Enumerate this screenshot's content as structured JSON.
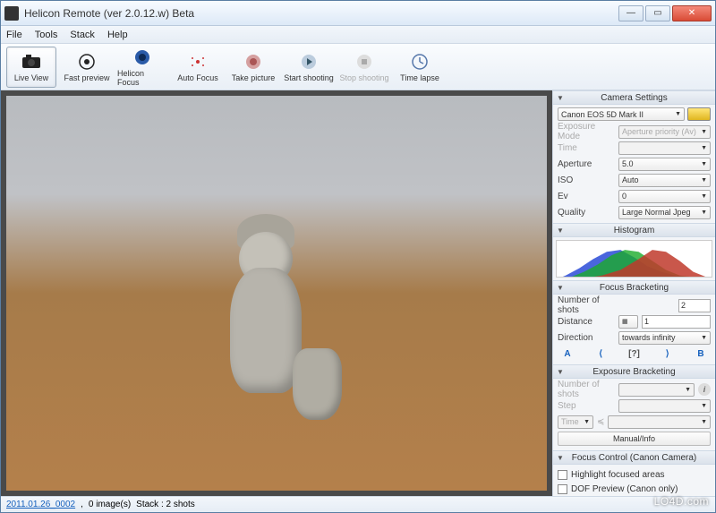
{
  "window": {
    "title": "Helicon Remote (ver 2.0.12.w) Beta"
  },
  "menu": {
    "file": "File",
    "tools": "Tools",
    "stack": "Stack",
    "help": "Help"
  },
  "toolbar": {
    "live_view": "Live View",
    "fast_preview": "Fast preview",
    "helicon_focus": "Helicon Focus",
    "auto_focus": "Auto Focus",
    "take_picture": "Take picture",
    "start_shooting": "Start shooting",
    "stop_shooting": "Stop shooting",
    "time_lapse": "Time lapse"
  },
  "panels": {
    "camera_settings": {
      "title": "Camera Settings",
      "camera": "Canon EOS 5D Mark II",
      "exposure_mode_label": "Exposure Mode",
      "exposure_mode": "Aperture priority (Av)",
      "time_label": "Time",
      "time": "",
      "aperture_label": "Aperture",
      "aperture": "5.0",
      "iso_label": "ISO",
      "iso": "Auto",
      "ev_label": "Ev",
      "ev": "0",
      "quality_label": "Quality",
      "quality": "Large Normal Jpeg"
    },
    "histogram": {
      "title": "Histogram"
    },
    "focus_bracketing": {
      "title": "Focus Bracketing",
      "shots_label": "Number of shots",
      "shots": "2",
      "distance_label": "Distance",
      "distance": "1",
      "direction_label": "Direction",
      "direction": "towards infinity",
      "btn_a": "A",
      "btn_q": "[?]",
      "btn_b": "B"
    },
    "exposure_bracketing": {
      "title": "Exposure Bracketing",
      "shots_label": "Number of shots",
      "step_label": "Step",
      "time_label": "Time",
      "manual": "Manual/Info"
    },
    "focus_control": {
      "title": "Focus Control (Canon Camera)",
      "highlight": "Highlight focused areas",
      "dof": "DOF Preview (Canon only)"
    }
  },
  "status": {
    "filename": "2011.01.26_0002",
    "images": "0 image(s)",
    "stack": "Stack : 2 shots"
  },
  "watermark": "LO4D.com",
  "chart_data": {
    "type": "area",
    "title": "Histogram",
    "xlabel": "",
    "ylabel": "",
    "x": [
      0,
      16,
      32,
      48,
      64,
      80,
      96,
      112,
      128,
      144,
      160,
      176,
      192,
      208,
      224,
      240,
      255
    ],
    "series": [
      {
        "name": "blue",
        "values": [
          0,
          4,
          10,
          18,
          26,
          30,
          24,
          16,
          10,
          6,
          3,
          1,
          0,
          0,
          0,
          0,
          0
        ],
        "color": "#2a4bd7"
      },
      {
        "name": "green",
        "values": [
          0,
          2,
          6,
          12,
          20,
          28,
          32,
          28,
          20,
          12,
          6,
          2,
          0,
          0,
          0,
          0,
          0
        ],
        "color": "#1aab2b"
      },
      {
        "name": "red",
        "values": [
          0,
          0,
          1,
          3,
          6,
          10,
          16,
          24,
          30,
          32,
          26,
          18,
          10,
          4,
          1,
          0,
          0
        ],
        "color": "#c0392b"
      }
    ],
    "xlim": [
      0,
      255
    ],
    "ylim": [
      0,
      35
    ]
  }
}
